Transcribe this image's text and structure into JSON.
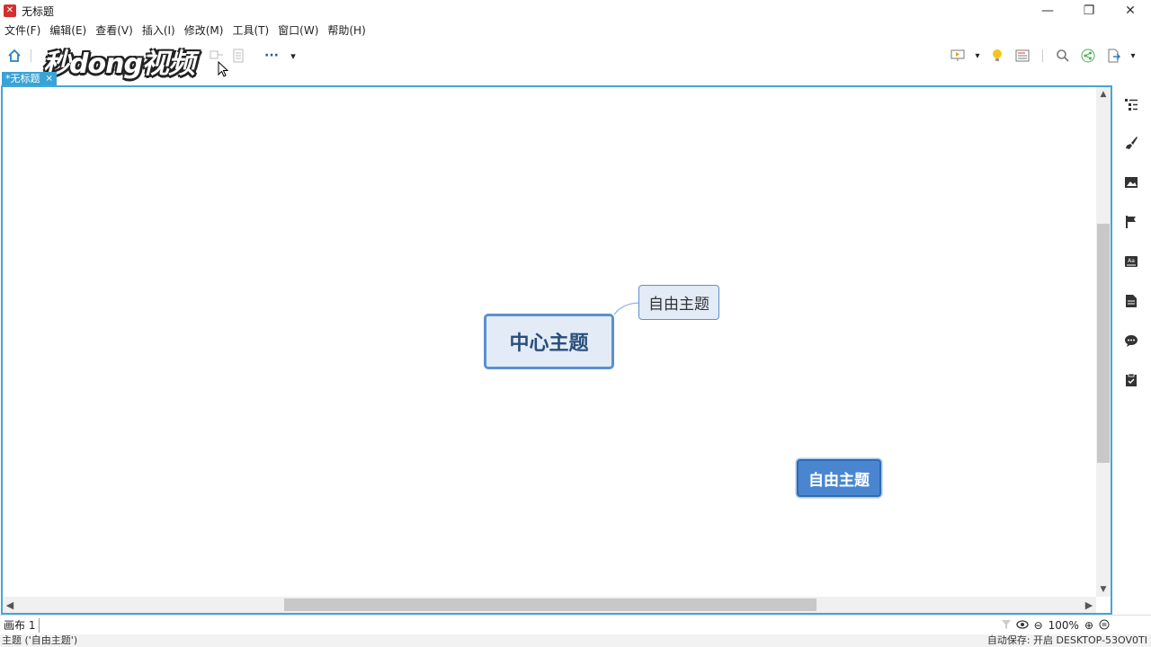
{
  "window": {
    "title": "无标题",
    "controls": {
      "minimize": "—",
      "maximize": "❐",
      "close": "✕"
    }
  },
  "menu": [
    "文件(F)",
    "编辑(E)",
    "查看(V)",
    "插入(I)",
    "修改(M)",
    "工具(T)",
    "窗口(W)",
    "帮助(H)"
  ],
  "watermark": "秒dong视频",
  "toolbar": {
    "more": "···",
    "dropdown": "▾"
  },
  "doc_tab": {
    "label": "*无标题",
    "close": "×"
  },
  "canvas": {
    "central_topic": "中心主题",
    "floating_topic_1": "自由主题",
    "floating_topic_2": "自由主题"
  },
  "scroll": {
    "up": "▲",
    "down": "▼",
    "left": "◀",
    "right": "▶"
  },
  "sheet": {
    "tab": "画布 1",
    "zoom": "100%",
    "zoom_out": "⊖",
    "zoom_in": "⊕"
  },
  "status": {
    "left": "主题 ('自由主题')",
    "right": "自动保存: 开启  DESKTOP-53OV0TI"
  },
  "colors": {
    "accent": "#44a6d8",
    "topic_border": "#5b91cf",
    "topic_fill": "#e3ebf6",
    "selected_fill": "#4a86cf"
  }
}
